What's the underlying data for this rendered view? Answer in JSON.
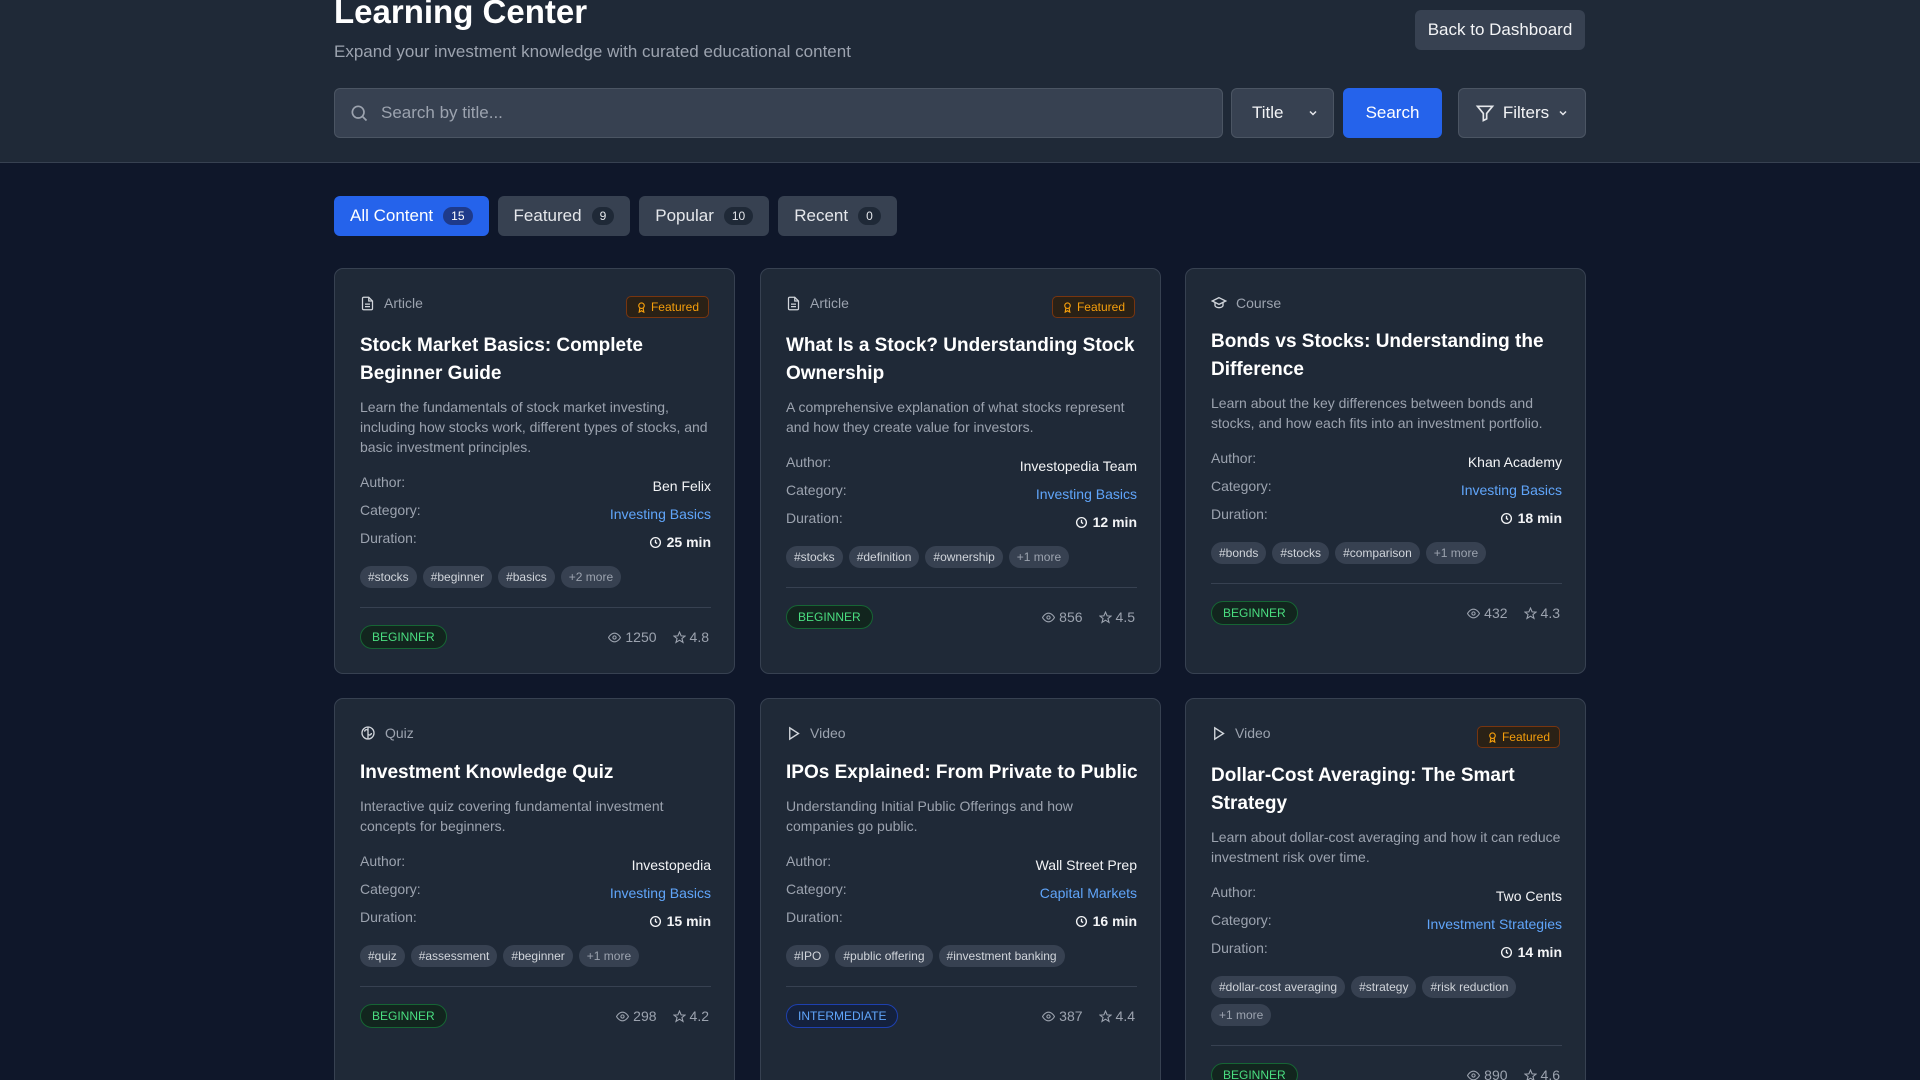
{
  "header": {
    "title": "Learning Center",
    "subtitle": "Expand your investment knowledge with curated educational content",
    "back_label": "Back to Dashboard"
  },
  "search": {
    "placeholder": "Search by title...",
    "field_select": "Title",
    "button_label": "Search",
    "filters_label": "Filters"
  },
  "tabs": [
    {
      "label": "All Content",
      "count": "15",
      "active": true
    },
    {
      "label": "Featured",
      "count": "9"
    },
    {
      "label": "Popular",
      "count": "10"
    },
    {
      "label": "Recent",
      "count": "0"
    }
  ],
  "labels": {
    "author": "Author:",
    "category": "Category:",
    "duration": "Duration:",
    "featured": "Featured"
  },
  "cards": [
    {
      "type": "Article",
      "type_icon": "document-icon",
      "featured": true,
      "title": "Stock Market Basics: Complete Beginner Guide",
      "description": "Learn the fundamentals of stock market investing, including how stocks work, different types of stocks, and basic investment principles.",
      "author": "Ben Felix",
      "category": "Investing Basics",
      "duration": "25 min",
      "tags": [
        "#stocks",
        "#beginner",
        "#basics"
      ],
      "more": "+2 more",
      "level": "BEGINNER",
      "views": "1250",
      "rating": "4.8"
    },
    {
      "type": "Article",
      "type_icon": "document-icon",
      "featured": true,
      "title": "What Is a Stock? Understanding Stock Ownership",
      "description": "A comprehensive explanation of what stocks represent and how they create value for investors.",
      "author": "Investopedia Team",
      "category": "Investing Basics",
      "duration": "12 min",
      "tags": [
        "#stocks",
        "#definition",
        "#ownership"
      ],
      "more": "+1 more",
      "level": "BEGINNER",
      "views": "856",
      "rating": "4.5"
    },
    {
      "type": "Course",
      "type_icon": "graduation-cap-icon",
      "featured": false,
      "title": "Bonds vs Stocks: Understanding the Difference",
      "description": "Learn about the key differences between bonds and stocks, and how each fits into an investment portfolio.",
      "author": "Khan Academy",
      "category": "Investing Basics",
      "duration": "18 min",
      "tags": [
        "#bonds",
        "#stocks",
        "#comparison"
      ],
      "more": "+1 more",
      "level": "BEGINNER",
      "views": "432",
      "rating": "4.3"
    },
    {
      "type": "Quiz",
      "type_icon": "brain-icon",
      "featured": false,
      "title": "Investment Knowledge Quiz",
      "description": "Interactive quiz covering fundamental investment concepts for beginners.",
      "author": "Investopedia",
      "category": "Investing Basics",
      "duration": "15 min",
      "tags": [
        "#quiz",
        "#assessment",
        "#beginner"
      ],
      "more": "+1 more",
      "level": "BEGINNER",
      "views": "298",
      "rating": "4.2"
    },
    {
      "type": "Video",
      "type_icon": "play-icon",
      "featured": false,
      "title": "IPOs Explained: From Private to Public",
      "description": "Understanding Initial Public Offerings and how companies go public.",
      "author": "Wall Street Prep",
      "category": "Capital Markets",
      "duration": "16 min",
      "tags": [
        "#IPO",
        "#public offering",
        "#investment banking"
      ],
      "more": "",
      "level": "INTERMEDIATE",
      "views": "387",
      "rating": "4.4"
    },
    {
      "type": "Video",
      "type_icon": "play-icon",
      "featured": true,
      "title": "Dollar-Cost Averaging: The Smart Strategy",
      "description": "Learn about dollar-cost averaging and how it can reduce investment risk over time.",
      "author": "Two Cents",
      "category": "Investment Strategies",
      "duration": "14 min",
      "tags": [
        "#dollar-cost averaging",
        "#strategy",
        "#risk reduction"
      ],
      "more": "+1 more",
      "level": "BEGINNER",
      "views": "890",
      "rating": "4.6"
    }
  ]
}
